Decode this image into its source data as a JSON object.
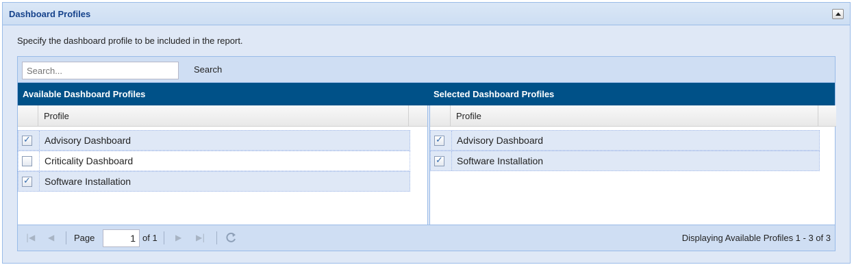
{
  "panel": {
    "title": "Dashboard Profiles",
    "description": "Specify the dashboard profile to be included in the report."
  },
  "search": {
    "placeholder": "Search...",
    "button_label": "Search"
  },
  "available": {
    "heading": "Available Dashboard Profiles",
    "column": "Profile",
    "rows": [
      {
        "label": "Advisory Dashboard",
        "checked": true
      },
      {
        "label": "Criticality Dashboard",
        "checked": false
      },
      {
        "label": "Software Installation",
        "checked": true
      }
    ]
  },
  "selected": {
    "heading": "Selected Dashboard Profiles",
    "column": "Profile",
    "rows": [
      {
        "label": "Advisory Dashboard",
        "checked": true
      },
      {
        "label": "Software Installation",
        "checked": true
      }
    ]
  },
  "pager": {
    "page_label": "Page",
    "page_value": "1",
    "of_label": "of 1",
    "display_text": "Displaying Available Profiles 1 - 3 of 3"
  },
  "icons": [
    "collapse-icon",
    "first-page-icon",
    "prev-page-icon",
    "next-page-icon",
    "last-page-icon",
    "refresh-icon",
    "checkbox-icon"
  ],
  "colors": {
    "header_blue": "#005188",
    "title_blue": "#15428b",
    "panel_bg": "#dfe8f6"
  }
}
